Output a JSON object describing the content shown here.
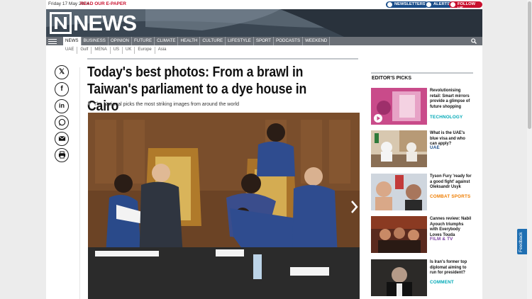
{
  "top_bar": {
    "date": "Friday 17 May 2024",
    "epaper": "READ OUR E-PAPER",
    "newsletters": "NEWSLETTERS",
    "alerts": "ALERTS",
    "follow": "FOLLOW US"
  },
  "masthead": {
    "logo": "NEWS"
  },
  "nav": {
    "items": [
      "NEWS",
      "BUSINESS",
      "OPINION",
      "FUTURE",
      "CLIMATE",
      "HEALTH",
      "CULTURE",
      "LIFESTYLE",
      "SPORT",
      "PODCASTS",
      "WEEKEND"
    ]
  },
  "subnav": {
    "items": [
      "UAE",
      "Gulf",
      "MENA",
      "US",
      "UK",
      "Europe",
      "Asia"
    ]
  },
  "share": {
    "icons": [
      "x-icon",
      "facebook-icon",
      "linkedin-icon",
      "whatsapp-icon",
      "email-icon",
      "print-icon"
    ]
  },
  "article": {
    "headline": "Today's best photos: From a brawl in Taiwan's parliament to a dye house in Cairo",
    "standfirst": "The National picks the most striking images from around the world"
  },
  "rail": {
    "title": "EDITOR'S PICKS",
    "picks": [
      {
        "title": "Revolutionising retail: Smart mirrors provide a glimpse of future shopping",
        "category": "TECHNOLOGY",
        "color": "#00a9b7"
      },
      {
        "title": "What is the UAE's blue visa and who can apply?",
        "category": "UAE",
        "color": "#1b4e8a"
      },
      {
        "title": "Tyson Fury 'ready for a good fight' against Oleksandr Usyk",
        "category": "COMBAT SPORTS",
        "color": "#ef7d00"
      },
      {
        "title": "Cannes review: Nabil Ayouch triumphs with Everybody Loves Touda",
        "category": "FILM & TV",
        "color": "#7b3fa0"
      },
      {
        "title": "Is Iran's former top diplomat aiming to run for president?",
        "category": "COMMENT",
        "color": "#00a9b7"
      }
    ]
  },
  "feedback": "Feedback"
}
